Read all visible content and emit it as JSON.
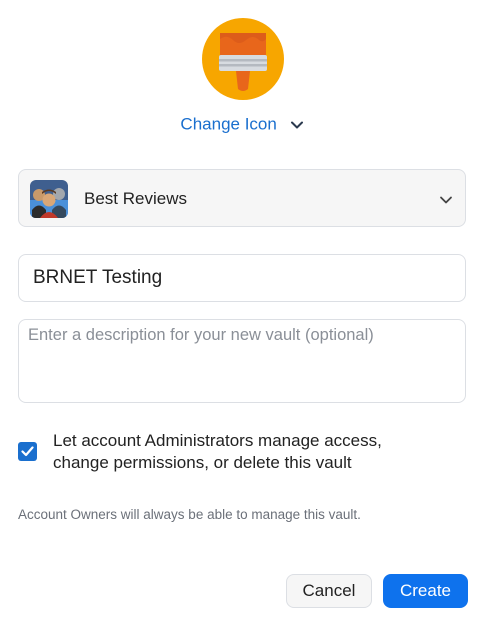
{
  "vault_icon": {
    "name": "paintbrush-icon",
    "background_color": "#f7a600",
    "brush_color": "#e8661b",
    "ferrule_color": "#d7dbe0"
  },
  "change_icon": {
    "label": "Change Icon",
    "chevron": "chevron-down-icon"
  },
  "account": {
    "name": "Best Reviews",
    "avatar": "team-avatar-icon",
    "chevron": "chevron-down-icon"
  },
  "vault_name": {
    "value": "BRNET Testing"
  },
  "description": {
    "value": "",
    "placeholder": "Enter a description for your new vault (optional)"
  },
  "admin_permission": {
    "checked": true,
    "label_line1": "Let account Administrators manage access,",
    "label_line2": "change permissions, or delete this vault"
  },
  "owner_note": "Account Owners will always be able to manage this vault.",
  "buttons": {
    "cancel": "Cancel",
    "create": "Create"
  },
  "colors": {
    "accent": "#0e72ed",
    "link": "#1a6fce"
  }
}
